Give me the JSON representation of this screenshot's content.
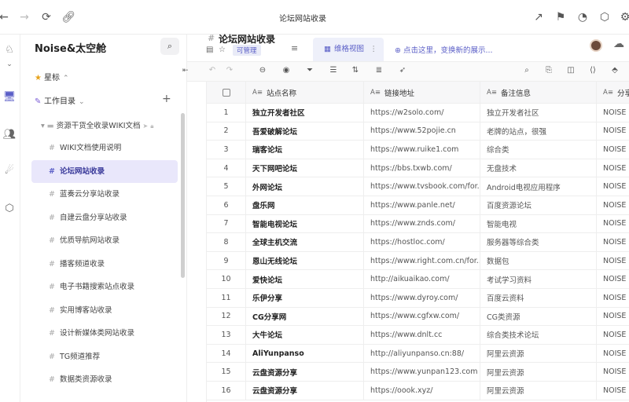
{
  "window": {
    "title": "论坛网站收录"
  },
  "sidebar": {
    "title": "Noise&太空舱",
    "starred_label": "星标",
    "catalog_label": "工作目录",
    "tree_root": "资源干货全收录WIKI文档",
    "items": [
      {
        "label": "WIKI文档使用说明"
      },
      {
        "label": "论坛网站收录"
      },
      {
        "label": "蓝奏云分享站收录"
      },
      {
        "label": "自建云盘分享站收录"
      },
      {
        "label": "优质导航网站收录"
      },
      {
        "label": "播客频道收录"
      },
      {
        "label": "电子书籍搜索站点收录"
      },
      {
        "label": "实用博客站收录"
      },
      {
        "label": "设计新媒体类网站收录"
      },
      {
        "label": "TG频道推荐"
      },
      {
        "label": "数据类资源收录"
      }
    ]
  },
  "doc": {
    "title": "论坛网站收录",
    "tag": "可管理",
    "view_tab": "维格视图",
    "add_view": "点击这里，变换新的展示..."
  },
  "table": {
    "columns": [
      "站点名称",
      "链接地址",
      "备注信息",
      "分享"
    ],
    "rows": [
      {
        "idx": "1",
        "name": "独立开发者社区",
        "url": "https://w2solo.com/",
        "note": "独立开发者社区",
        "share": "NOISE"
      },
      {
        "idx": "2",
        "name": "吾爱破解论坛",
        "url": "https://www.52pojie.cn",
        "note": "老牌的站点，很强",
        "share": "NOISE"
      },
      {
        "idx": "3",
        "name": "瑞客论坛",
        "url": "https://www.ruike1.com",
        "note": "综合类",
        "share": "NOISE"
      },
      {
        "idx": "4",
        "name": "天下网吧论坛",
        "url": "https://bbs.txwb.com/",
        "note": "无盘技术",
        "share": "NOISE"
      },
      {
        "idx": "5",
        "name": "外网论坛",
        "url": "https://www.tvsbook.com/for...",
        "note": "Android电视应用程序",
        "share": "NOISE"
      },
      {
        "idx": "6",
        "name": "盘乐网",
        "url": "https://www.panle.net/",
        "note": "百度资源论坛",
        "share": "NOISE"
      },
      {
        "idx": "7",
        "name": "智能电视论坛",
        "url": "https://www.znds.com/",
        "note": "智能电视",
        "share": "NOISE"
      },
      {
        "idx": "8",
        "name": "全球主机交流",
        "url": "https://hostloc.com/",
        "note": "服务器等综合类",
        "share": "NOISE"
      },
      {
        "idx": "9",
        "name": "恩山无线论坛",
        "url": "https://www.right.com.cn/for...",
        "note": "数据包",
        "share": "NOISE"
      },
      {
        "idx": "10",
        "name": "爱快论坛",
        "url": "http://aikuaikao.com/",
        "note": "考试学习资料",
        "share": "NOISE"
      },
      {
        "idx": "11",
        "name": "乐伊分享",
        "url": "https://www.dyroy.com/",
        "note": "百度云资料",
        "share": "NOISE"
      },
      {
        "idx": "12",
        "name": "CG分享网",
        "url": "https://www.cgfxw.com/",
        "note": "CG类资源",
        "share": "NOISE"
      },
      {
        "idx": "13",
        "name": "大牛论坛",
        "url": "https://www.dnlt.cc",
        "note": "综合类技术论坛",
        "share": "NOISE"
      },
      {
        "idx": "14",
        "name": "AliYunpanso",
        "url": "http://aliyunpanso.cn:88/",
        "note": "阿里云资源",
        "share": "NOISE"
      },
      {
        "idx": "15",
        "name": "云盘资源分享",
        "url": "https://www.yunpan123.com",
        "note": "阿里云资源",
        "share": "NOISE"
      },
      {
        "idx": "16",
        "name": "云盘资源分享",
        "url": "https://oook.xyz/",
        "note": "阿里云资源",
        "share": "NOISE"
      }
    ]
  },
  "colors": {
    "accent": "#5b5fc7",
    "active_bg": "#e9e7fb"
  }
}
